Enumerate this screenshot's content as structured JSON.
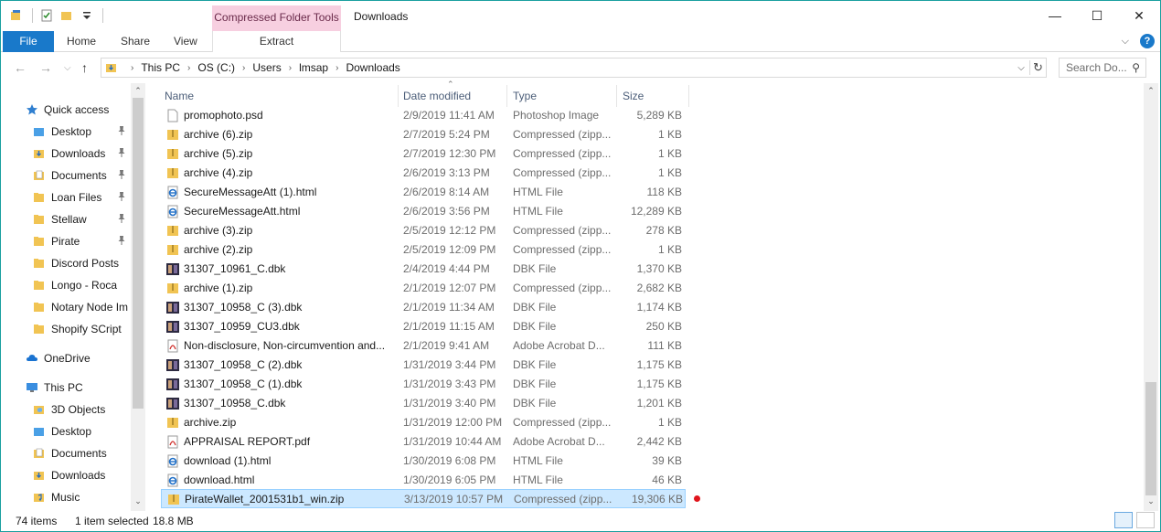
{
  "titlebar": {
    "context_tab": "Compressed Folder Tools",
    "title": "Downloads",
    "minimize": "—",
    "maximize": "☐",
    "close": "✕"
  },
  "ribbon": {
    "file": "File",
    "home": "Home",
    "share": "Share",
    "view": "View",
    "extract": "Extract",
    "expand_glyph": "⌵",
    "help_glyph": "?"
  },
  "nav": {
    "back_glyph": "←",
    "forward_glyph": "→",
    "recent_glyph": "⌵",
    "up_glyph": "↑",
    "breadcrumbs": [
      "This PC",
      "OS (C:)",
      "Users",
      "lmsap",
      "Downloads"
    ],
    "search_placeholder": "Search Do...",
    "search_glyph": "⚲",
    "dropdown_glyph": "⌵",
    "refresh_glyph": "↻"
  },
  "sidebar": {
    "items": [
      {
        "label": "Quick access",
        "icon": "star-icon",
        "level": 0,
        "pinned": false
      },
      {
        "label": "Desktop",
        "icon": "folder-blue-icon",
        "level": 1,
        "pinned": true
      },
      {
        "label": "Downloads",
        "icon": "download-folder-icon",
        "level": 1,
        "pinned": true
      },
      {
        "label": "Documents",
        "icon": "documents-folder-icon",
        "level": 1,
        "pinned": true
      },
      {
        "label": "Loan Files",
        "icon": "folder-icon",
        "level": 1,
        "pinned": true
      },
      {
        "label": "Stellaw",
        "icon": "folder-icon",
        "level": 1,
        "pinned": true
      },
      {
        "label": "Pirate",
        "icon": "folder-icon",
        "level": 1,
        "pinned": true
      },
      {
        "label": "Discord Posts",
        "icon": "folder-icon",
        "level": 1,
        "pinned": false
      },
      {
        "label": "Longo - Roca",
        "icon": "folder-icon",
        "level": 1,
        "pinned": false
      },
      {
        "label": "Notary Node Im",
        "icon": "folder-icon",
        "level": 1,
        "pinned": false
      },
      {
        "label": "Shopify SCript",
        "icon": "folder-icon",
        "level": 1,
        "pinned": false
      },
      {
        "label": "OneDrive",
        "icon": "cloud-icon",
        "level": 0,
        "pinned": false
      },
      {
        "label": "This PC",
        "icon": "computer-icon",
        "level": 0,
        "pinned": false
      },
      {
        "label": "3D Objects",
        "icon": "3d-objects-icon",
        "level": 1,
        "pinned": false
      },
      {
        "label": "Desktop",
        "icon": "folder-blue-icon",
        "level": 1,
        "pinned": false
      },
      {
        "label": "Documents",
        "icon": "documents-folder-icon",
        "level": 1,
        "pinned": false
      },
      {
        "label": "Downloads",
        "icon": "download-folder-icon",
        "level": 1,
        "pinned": false
      },
      {
        "label": "Music",
        "icon": "music-folder-icon",
        "level": 1,
        "pinned": false
      }
    ],
    "pin_glyph": "📌"
  },
  "columns": {
    "name": "Name",
    "date": "Date modified",
    "type": "Type",
    "size": "Size",
    "sort_glyph": "⌃"
  },
  "files": [
    {
      "name": "promophoto.psd",
      "date": "2/9/2019 11:41 AM",
      "type": "Photoshop Image",
      "size": "5,289 KB",
      "icon": "blank-file-icon"
    },
    {
      "name": "archive (6).zip",
      "date": "2/7/2019 5:24 PM",
      "type": "Compressed (zipp...",
      "size": "1 KB",
      "icon": "zip-folder-icon"
    },
    {
      "name": "archive (5).zip",
      "date": "2/7/2019 12:30 PM",
      "type": "Compressed (zipp...",
      "size": "1 KB",
      "icon": "zip-folder-icon"
    },
    {
      "name": "archive (4).zip",
      "date": "2/6/2019 3:13 PM",
      "type": "Compressed (zipp...",
      "size": "1 KB",
      "icon": "zip-folder-icon"
    },
    {
      "name": "SecureMessageAtt (1).html",
      "date": "2/6/2019 8:14 AM",
      "type": "HTML File",
      "size": "118 KB",
      "icon": "html-file-icon"
    },
    {
      "name": "SecureMessageAtt.html",
      "date": "2/6/2019 3:56 PM",
      "type": "HTML File",
      "size": "12,289 KB",
      "icon": "html-file-icon"
    },
    {
      "name": "archive (3).zip",
      "date": "2/5/2019 12:12 PM",
      "type": "Compressed (zipp...",
      "size": "278 KB",
      "icon": "zip-folder-icon"
    },
    {
      "name": "archive (2).zip",
      "date": "2/5/2019 12:09 PM",
      "type": "Compressed (zipp...",
      "size": "1 KB",
      "icon": "zip-folder-icon"
    },
    {
      "name": "31307_10961_C.dbk",
      "date": "2/4/2019 4:44 PM",
      "type": "DBK File",
      "size": "1,370 KB",
      "icon": "dbk-thumbnail-icon"
    },
    {
      "name": "archive (1).zip",
      "date": "2/1/2019 12:07 PM",
      "type": "Compressed (zipp...",
      "size": "2,682 KB",
      "icon": "zip-folder-icon"
    },
    {
      "name": "31307_10958_C (3).dbk",
      "date": "2/1/2019 11:34 AM",
      "type": "DBK File",
      "size": "1,174 KB",
      "icon": "dbk-thumbnail-icon"
    },
    {
      "name": "31307_10959_CU3.dbk",
      "date": "2/1/2019 11:15 AM",
      "type": "DBK File",
      "size": "250 KB",
      "icon": "dbk-thumbnail-icon"
    },
    {
      "name": "Non-disclosure, Non-circumvention and...",
      "date": "2/1/2019 9:41 AM",
      "type": "Adobe Acrobat D...",
      "size": "111 KB",
      "icon": "pdf-file-icon"
    },
    {
      "name": "31307_10958_C (2).dbk",
      "date": "1/31/2019 3:44 PM",
      "type": "DBK File",
      "size": "1,175 KB",
      "icon": "dbk-thumbnail-icon"
    },
    {
      "name": "31307_10958_C (1).dbk",
      "date": "1/31/2019 3:43 PM",
      "type": "DBK File",
      "size": "1,175 KB",
      "icon": "dbk-thumbnail-icon"
    },
    {
      "name": "31307_10958_C.dbk",
      "date": "1/31/2019 3:40 PM",
      "type": "DBK File",
      "size": "1,201 KB",
      "icon": "dbk-thumbnail-icon"
    },
    {
      "name": "archive.zip",
      "date": "1/31/2019 12:00 PM",
      "type": "Compressed (zipp...",
      "size": "1 KB",
      "icon": "zip-folder-icon"
    },
    {
      "name": "APPRAISAL REPORT.pdf",
      "date": "1/31/2019 10:44 AM",
      "type": "Adobe Acrobat D...",
      "size": "2,442 KB",
      "icon": "pdf-file-icon"
    },
    {
      "name": "download (1).html",
      "date": "1/30/2019 6:08 PM",
      "type": "HTML File",
      "size": "39 KB",
      "icon": "html-file-icon"
    },
    {
      "name": "download.html",
      "date": "1/30/2019 6:05 PM",
      "type": "HTML File",
      "size": "46 KB",
      "icon": "html-file-icon"
    },
    {
      "name": "PirateWallet_2001531b1_win.zip",
      "date": "3/13/2019 10:57 PM",
      "type": "Compressed (zipp...",
      "size": "19,306 KB",
      "icon": "zip-folder-icon",
      "selected": true
    }
  ],
  "status": {
    "item_count": "74 items",
    "selection": "1 item selected",
    "selection_size": "18.8 MB"
  },
  "scroll": {
    "up_glyph": "⌃",
    "down_glyph": "⌄"
  },
  "colors": {
    "accent": "#1979ca",
    "context_tab": "#f7cfe0",
    "selection": "#cce8ff",
    "folder": "#f1c453",
    "marker": "#e0151c"
  }
}
